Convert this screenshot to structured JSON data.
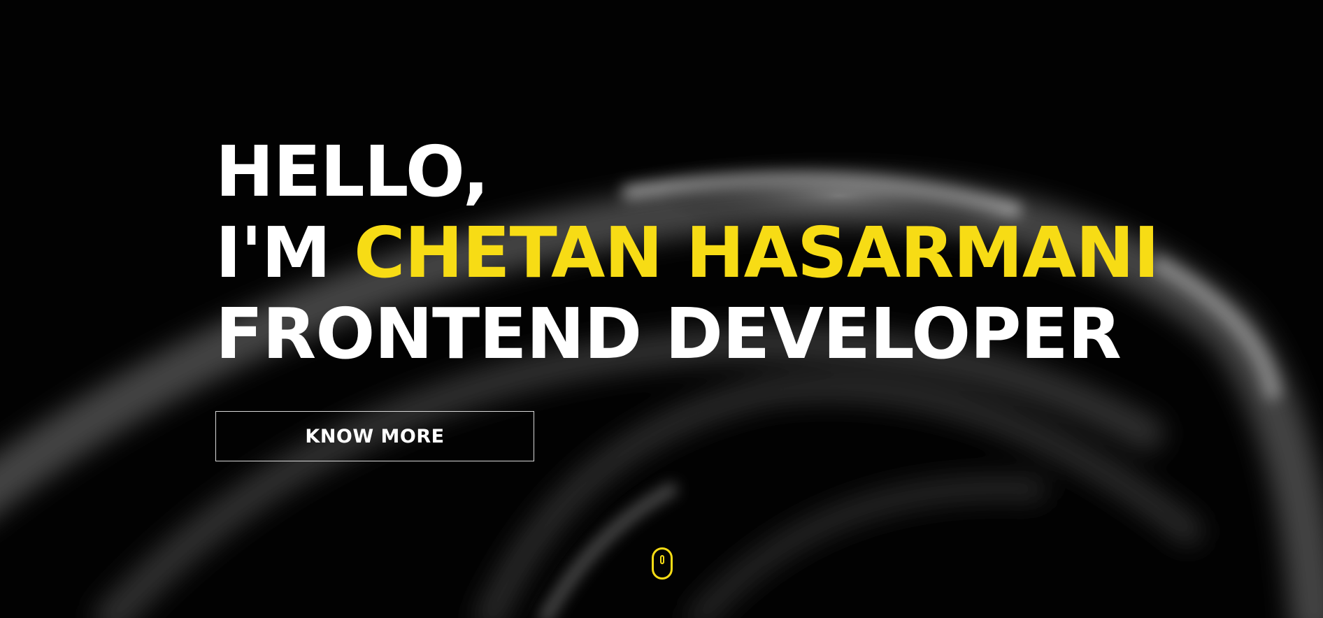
{
  "hero": {
    "greeting": "HELLO,",
    "intro_prefix": "I'M",
    "name": "CHETAN HASARMANI",
    "role": "FRONTEND DEVELOPER"
  },
  "cta": {
    "know_more_label": "KNOW MORE"
  },
  "icons": {
    "scroll": "mouse-scroll-icon"
  },
  "colors": {
    "background": "#000000",
    "accent": "#f7dc15",
    "text": "#ffffff"
  }
}
